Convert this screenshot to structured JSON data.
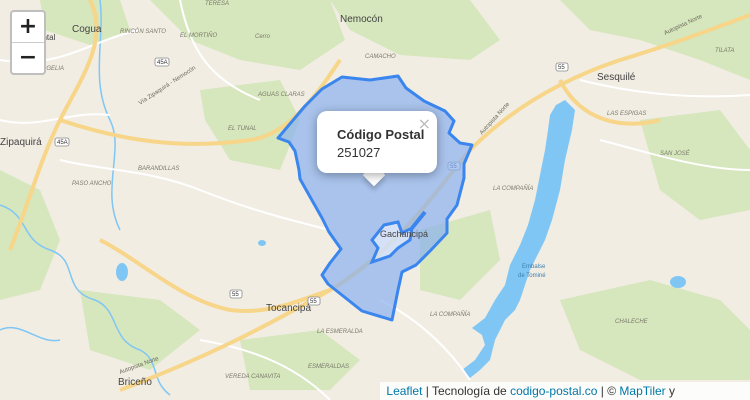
{
  "map": {
    "towns": {
      "cogua": "Cogua",
      "nemocon": "Nemocón",
      "sesquile": "Sesquilé",
      "zipaquira": "Zipaquirá",
      "tocancipa": "Tocancipá",
      "gachancipa": "Gachancipá",
      "briceno": "Briceño"
    },
    "places": {
      "teresa": "TERESA",
      "rincon_santo": "RINCÓN SANTO",
      "el_mortino": "EL MORTIÑO",
      "cerro": "Cerro",
      "argelia": "ARGELIA",
      "camacho": "CAMACHO",
      "aguas_claras": "AGUAS CLARAS",
      "el_tunal": "EL TUNAL",
      "barandillas": "BARANDILLAS",
      "paso_ancho": "PASO ANCHO",
      "la_compania": "LA COMPAÑÍA",
      "las_espigas": "LAS ESPIGAS",
      "san_jose": "SAN JOSÉ",
      "tilata": "TILATA",
      "la_esmeralda": "LA ESMERALDA",
      "la_compania_2": "LA COMPAÑÍA",
      "esmeraldas": "ESMERALDAS",
      "verbena_canavita": "VEREDA CANAVITA",
      "chalecie": "CHALECHE",
      "ental": "ental"
    },
    "water": {
      "lake_name_1": "Embalse",
      "lake_name_2": "de Tominé"
    },
    "roads": {
      "via_zipaquira": "Vía Zipaquirá - Nemocón",
      "autopista_norte_1": "Autopista Norte",
      "autopista_norte_2": "Autopista Norte",
      "autopista_norte_3": "Autopista Norte"
    },
    "shields": [
      "45A",
      "55",
      "55",
      "45A",
      "55",
      "55"
    ]
  },
  "zoom": {
    "in_label": "+",
    "out_label": "−"
  },
  "popup": {
    "title": "Código Postal",
    "postal_code": "251027",
    "close_label": "×"
  },
  "attribution": {
    "leaflet": "Leaflet",
    "sep1": " | Tecnología de ",
    "site": "codigo-postal.co",
    "sep2": " | © ",
    "maptiler": "MapTiler",
    "tail": " y"
  },
  "colors": {
    "land": "#f1ede3",
    "forest": "#d6e6bd",
    "water": "#7fc6f5",
    "road_major": "#f7d589",
    "polygon_fill": "#8ab0f0",
    "polygon_stroke": "#3a86ee"
  }
}
